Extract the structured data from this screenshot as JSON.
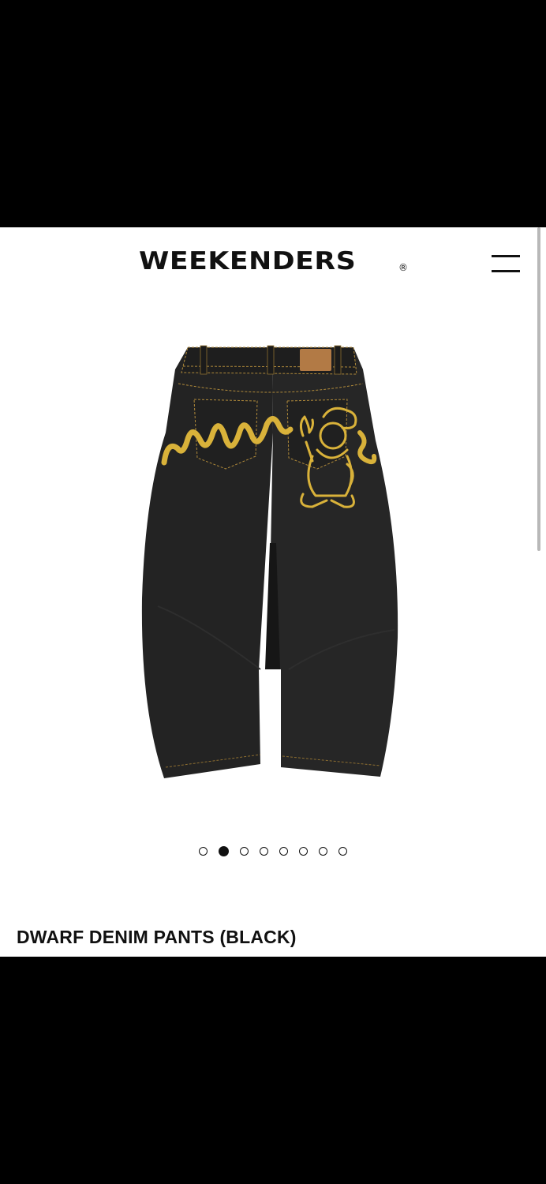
{
  "header": {
    "logo": "WEEKENDERS",
    "logo_mark": "®",
    "menu_icon": "hamburger-menu-icon"
  },
  "product": {
    "image_alt": "Dwarf denim pants black jeans with yellow embroidered dwarf and wave graphic",
    "gallery": {
      "count": 8,
      "active_index": 1
    },
    "title": "DWARF DENIM PANTS (BLACK)"
  },
  "colors": {
    "denim": "#232323",
    "stitch": "#b08a3a",
    "embroidery": "#d9b23a",
    "patch": "#b27a45"
  }
}
